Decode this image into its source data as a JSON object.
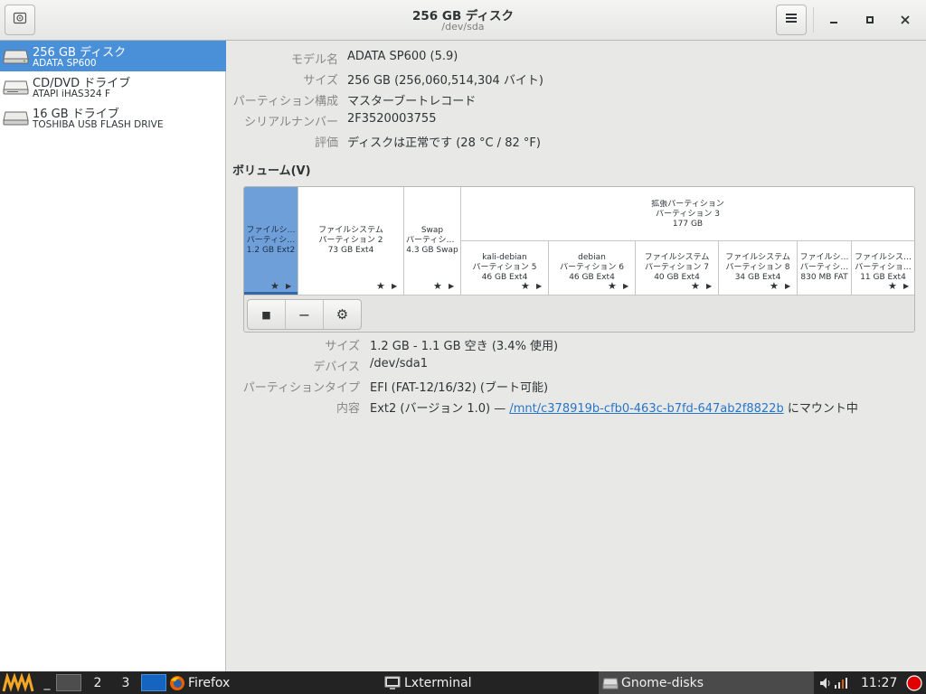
{
  "header": {
    "title": "256 GB ディスク",
    "subtitle": "/dev/sda",
    "menu_icon": "hamburger-menu-icon",
    "window_controls": {
      "minimize": "_",
      "maximize": "▫",
      "close": "✕"
    }
  },
  "sidebar": {
    "drives": [
      {
        "name": "256 GB ディスク",
        "model": "ADATA SP600",
        "icon": "hard-disk-icon",
        "selected": true
      },
      {
        "name": "CD/DVD ドライブ",
        "model": "ATAPI   iHAS324   F",
        "icon": "optical-drive-icon",
        "selected": false
      },
      {
        "name": "16 GB ドライブ",
        "model": "TOSHIBA USB FLASH DRIVE",
        "icon": "usb-drive-icon",
        "selected": false
      }
    ]
  },
  "disk_info": {
    "model_label": "モデル名",
    "model_value": "ADATA SP600 (5.9)",
    "size_label": "サイズ",
    "size_value": "256 GB (256,060,514,304 バイト)",
    "partitioning_label": "パーティション構成",
    "partitioning_value": "マスターブートレコード",
    "serial_label": "シリアルナンバー",
    "serial_value": "2F3520003755",
    "assessment_label": "評価",
    "assessment_value": "ディスクは正常です (28 °C / 82 °F)"
  },
  "volumes": {
    "title": "ボリューム(V)",
    "extended": {
      "line1": "拡張パーティション",
      "line2": "パーティション 3",
      "line3": "177 GB"
    },
    "partitions": [
      {
        "line1": "ファイルシ…",
        "line2": "パーティシ…",
        "line3": "1.2 GB Ext2",
        "selected": true
      },
      {
        "line1": "ファイルシステム",
        "line2": "パーティション 2",
        "line3": "73 GB Ext4"
      },
      {
        "line1": "Swap",
        "line2": "パーティショ…",
        "line3": "4.3 GB Swap"
      },
      {
        "line1": "kali-debian",
        "line2": "パーティション 5",
        "line3": "46 GB Ext4"
      },
      {
        "line1": "debian",
        "line2": "パーティション 6",
        "line3": "46 GB Ext4"
      },
      {
        "line1": "ファイルシステム",
        "line2": "パーティション 7",
        "line3": "40 GB Ext4"
      },
      {
        "line1": "ファイルシステム",
        "line2": "パーティション 8",
        "line3": "34 GB Ext4"
      },
      {
        "line1": "ファイルシ…",
        "line2": "パーティシ…",
        "line3": "830 MB FAT"
      },
      {
        "line1": "ファイルシス…",
        "line2": "パーティショ…",
        "line3": "11 GB Ext4"
      }
    ],
    "toolbar": {
      "stop": "■",
      "remove": "−",
      "settings": "⚙"
    }
  },
  "partition_info": {
    "size_label": "サイズ",
    "size_value": "1.2 GB - 1.1 GB 空き (3.4% 使用)",
    "device_label": "デバイス",
    "device_value": "/dev/sda1",
    "type_label": "パーティションタイプ",
    "type_value": "EFI (FAT-12/16/32) (ブート可能)",
    "contents_label": "内容",
    "contents_prefix": "Ext2 (バージョン 1.0) — ",
    "contents_link": "/mnt/c378919b-cfb0-463c-b7fd-647ab2f8822b",
    "contents_suffix": " にマウント中"
  },
  "taskbar": {
    "minimize_all": "_",
    "desktop2": "2",
    "desktop3": "3",
    "firefox": "Firefox",
    "lxterminal": "Lxterminal",
    "gnome_disks": "Gnome-disks",
    "clock": "11:27"
  }
}
